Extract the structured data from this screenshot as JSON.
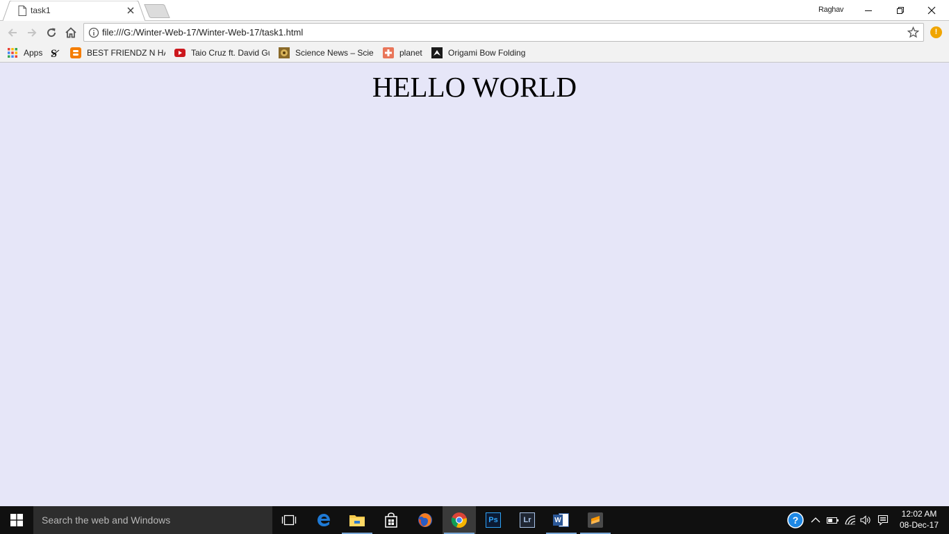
{
  "browser": {
    "tab": {
      "title": "task1",
      "close_icon": "close-icon"
    },
    "profile_name": "Raghav",
    "window_controls": [
      "minimize-icon",
      "restore-icon",
      "close-icon"
    ],
    "address_bar": {
      "url": "file:///G:/Winter-Web-17/Winter-Web-17/task1.html"
    },
    "extension_alert_glyph": "!",
    "accent_colors": {
      "alert": "#f0a500",
      "page_background": "#e6e6f8"
    }
  },
  "bookmarks": [
    {
      "label": "Apps",
      "icon": "apps-grid-icon"
    },
    {
      "label": "",
      "icon": "s-logo-icon"
    },
    {
      "label": "BEST FRIENDZ N HAC",
      "icon": "blogger-icon"
    },
    {
      "label": "Taio Cruz ft. David Gu",
      "icon": "youtube-icon"
    },
    {
      "label": "Science News – Scien",
      "icon": "science-news-icon"
    },
    {
      "label": "planet",
      "icon": "planet-icon"
    },
    {
      "label": "Origami Bow Folding",
      "icon": "origami-icon"
    }
  ],
  "page": {
    "heading": "HELLO WORLD"
  },
  "taskbar": {
    "search_placeholder": "Search the web and Windows",
    "apps": [
      "task-view-icon",
      "edge-icon",
      "file-explorer-icon",
      "store-icon",
      "firefox-icon",
      "chrome-icon",
      "photoshop-icon",
      "lightroom-icon",
      "word-icon",
      "sublime-text-icon"
    ],
    "photoshop_label": "Ps",
    "lightroom_label": "Lr",
    "word_label": "W",
    "clock": {
      "time": "12:02 AM",
      "date": "08-Dec-17"
    }
  }
}
